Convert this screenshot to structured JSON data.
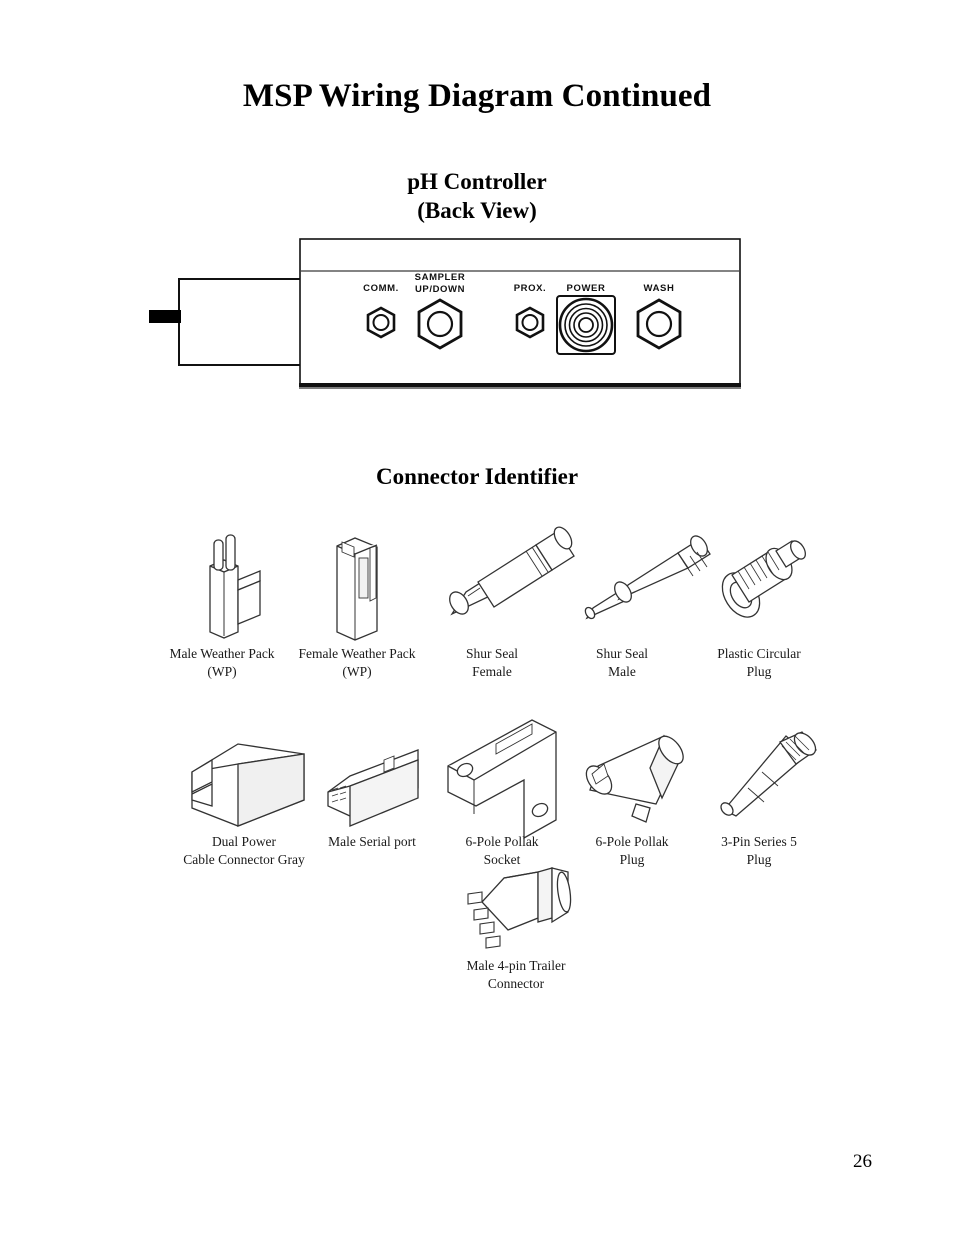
{
  "document": {
    "title": "MSP Wiring Diagram Continued",
    "page_number": "26"
  },
  "ph_controller": {
    "heading_line1": "pH Controller",
    "heading_line2": "(Back View)",
    "ports": [
      {
        "id": "comm",
        "label_line1": "COMM.",
        "label_line2": ""
      },
      {
        "id": "sampler",
        "label_line1": "SAMPLER",
        "label_line2": "UP/DOWN"
      },
      {
        "id": "prox",
        "label_line1": "PROX.",
        "label_line2": ""
      },
      {
        "id": "power",
        "label_line1": "POWER",
        "label_line2": ""
      },
      {
        "id": "wash",
        "label_line1": "WASH",
        "label_line2": ""
      }
    ]
  },
  "connector_identifier": {
    "heading": "Connector Identifier",
    "rows": [
      {
        "items": [
          {
            "icon": "male-weather-pack-icon",
            "label_line1": "Male Weather Pack",
            "label_line2": "(WP)"
          },
          {
            "icon": "female-weather-pack-icon",
            "label_line1": "Female Weather Pack",
            "label_line2": "(WP)"
          },
          {
            "icon": "shur-seal-female-icon",
            "label_line1": "Shur Seal",
            "label_line2": "Female"
          },
          {
            "icon": "shur-seal-male-icon",
            "label_line1": "Shur Seal",
            "label_line2": "Male"
          },
          {
            "icon": "plastic-circular-plug-icon",
            "label_line1": "Plastic Circular",
            "label_line2": "Plug"
          }
        ]
      },
      {
        "items": [
          {
            "icon": "dual-power-cable-connector-icon",
            "label_line1": "Dual Power",
            "label_line2": "Cable Connector Gray"
          },
          {
            "icon": "male-serial-port-icon",
            "label_line1": "Male Serial port",
            "label_line2": ""
          },
          {
            "icon": "pollak-socket-icon",
            "label_line1": "6-Pole Pollak",
            "label_line2": "Socket"
          },
          {
            "icon": "pollak-plug-icon",
            "label_line1": "6-Pole Pollak",
            "label_line2": "Plug"
          },
          {
            "icon": "series5-plug-icon",
            "label_line1": "3-Pin Series 5",
            "label_line2": "Plug"
          }
        ]
      },
      {
        "items": [
          {
            "icon": "male-4pin-trailer-connector-icon",
            "label_line1": "Male 4-pin Trailer",
            "label_line2": "Connector"
          }
        ]
      }
    ]
  },
  "colors": {
    "ink": "#000000",
    "paper": "#ffffff",
    "line": "#1a1a1a",
    "shade": "#9a9a9a"
  }
}
